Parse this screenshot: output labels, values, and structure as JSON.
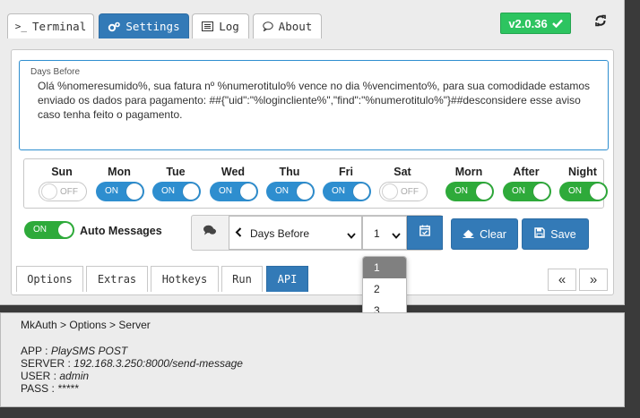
{
  "tabs": [
    {
      "label": "Terminal",
      "icon": "terminal-icon"
    },
    {
      "label": "Settings",
      "icon": "cogs-icon"
    },
    {
      "label": "Log",
      "icon": "list-icon"
    },
    {
      "label": "About",
      "icon": "comment-icon"
    }
  ],
  "active_tab": "Settings",
  "version": "v2.0.36",
  "message": {
    "label": "Days Before",
    "text": "Olá %nomeresumido%, sua fatura nº %numerotitulo% vence no dia %vencimento%, para sua comodidade estamos enviado os dados para pagamento: ##{\"uid\":\"%logincliente%\",\"find\":\"%numerotitulo%\"}##desconsidere esse aviso caso tenha feito o pagamento."
  },
  "days": [
    {
      "label": "Sun",
      "state": "OFF"
    },
    {
      "label": "Mon",
      "state": "ON"
    },
    {
      "label": "Tue",
      "state": "ON"
    },
    {
      "label": "Wed",
      "state": "ON"
    },
    {
      "label": "Thu",
      "state": "ON"
    },
    {
      "label": "Fri",
      "state": "ON"
    },
    {
      "label": "Sat",
      "state": "OFF"
    }
  ],
  "periods": [
    {
      "label": "Morn",
      "state": "ON"
    },
    {
      "label": "After",
      "state": "ON"
    },
    {
      "label": "Night",
      "state": "ON"
    }
  ],
  "auto_messages": {
    "label": "Auto Messages",
    "state": "ON"
  },
  "schedule": {
    "selected_type": "Days Before",
    "selected_number": "1",
    "number_options": [
      "1",
      "2",
      "3"
    ]
  },
  "buttons": {
    "clear": "Clear",
    "save": "Save"
  },
  "subtabs": [
    "Options",
    "Extras",
    "Hotkeys",
    "Run",
    "API"
  ],
  "active_subtab": "API",
  "pager": {
    "prev": "«",
    "next": "»"
  },
  "server_info": {
    "breadcrumb": "MkAuth > Options > Server",
    "app_label": "APP :",
    "app_value": "PlaySMS POST",
    "server_label": "SERVER :",
    "server_value": "192.168.3.250:8000/send-message",
    "user_label": "USER :",
    "user_value": "admin",
    "pass_label": "PASS :",
    "pass_value": "*****"
  },
  "colors": {
    "primary": "#337ab7",
    "success": "#2dc460",
    "toggle_green": "#2eaa3a",
    "toggle_blue": "#2e8ecf"
  }
}
